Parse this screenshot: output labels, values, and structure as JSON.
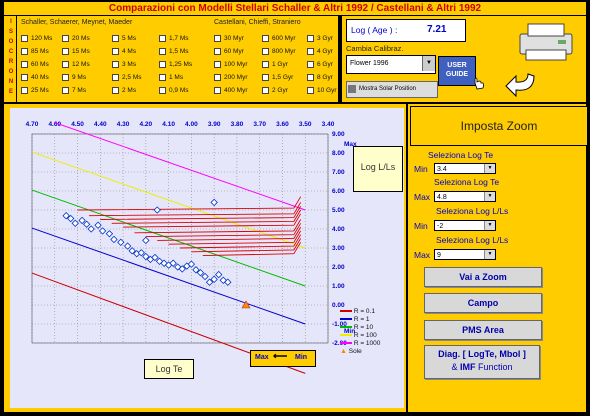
{
  "title": "Comparazioni con Modelli Stellari Schaller & Altri 1992 / Castellani & Altri 1992",
  "isocrone_label": "ISOCRONE",
  "isocrone_letters": [
    "I",
    "S",
    "O",
    "C",
    "R",
    "O",
    "N",
    "E"
  ],
  "group_left": {
    "header": "Schaller, Schaerer, Meynet, Maeder",
    "items": [
      "120 Ms",
      "20 Ms",
      "5 Ms",
      "1,7 Ms",
      "85 Ms",
      "15 Ms",
      "4 Ms",
      "1,5 Ms",
      "60 Ms",
      "12 Ms",
      "3 Ms",
      "1,25 Ms",
      "40 Ms",
      "9 Ms",
      "2,5 Ms",
      "1 Ms",
      "25 Ms",
      "7 Ms",
      "2 Ms",
      "0,9 Ms"
    ]
  },
  "group_right": {
    "header": "Castellani, Chieffi, Straniero",
    "items": [
      "30 Myr",
      "600 Myr",
      "3 Gyr",
      "60 Myr",
      "800 Myr",
      "4 Gyr",
      "100 Myr",
      "1 Gyr",
      "6 Gyr",
      "200 Myr",
      "1,5 Gyr",
      "8 Gyr",
      "400 Myr",
      "2 Gyr",
      "10 Gyr"
    ]
  },
  "log_age": {
    "label": "Log ( Age ) :",
    "value": "7.21"
  },
  "calibraz": {
    "label": "Cambia Calibraz.",
    "value": "Flower 1996"
  },
  "user_guide": "USER GUIDE",
  "sun_button": "Mostra Solar Position",
  "zoom": {
    "title": "Imposta Zoom",
    "te_header": "Seleziona Log Te",
    "te_min": "3.4",
    "te_max": "4.8",
    "ll_header": "Seleziona Log L/Ls",
    "ll_min": "-2",
    "ll_max": "9",
    "min_label": "Min",
    "max_label": "Max"
  },
  "buttons": {
    "vai_zoom": "Vai a Zoom",
    "campo": "Campo",
    "pms": "PMS Area",
    "diag_line1": "Diag. [ LogTe, Mbol ]",
    "diag_line2_pre": "& ",
    "diag_line2_imf": "IMF",
    "diag_line2_post": " Function"
  },
  "chart_data": {
    "type": "scatter",
    "xlabel": "Log Te",
    "ylabel": "Log L/Ls",
    "x_ticks": [
      "4.70",
      "4.60",
      "4.50",
      "4.40",
      "4.30",
      "4.20",
      "4.10",
      "4.00",
      "3.90",
      "3.80",
      "3.70",
      "3.60",
      "3.50",
      "3.40"
    ],
    "y_ticks": [
      "9.00",
      "8.00",
      "7.00",
      "6.00",
      "5.00",
      "4.00",
      "3.00",
      "2.00",
      "1.00",
      "0.00",
      "-1.00",
      "-2.00"
    ],
    "xlim": [
      4.7,
      3.4
    ],
    "ylim": [
      -2,
      9
    ],
    "corner_labels": {
      "max_top": "Max",
      "min_right": "Min"
    },
    "direction_label": {
      "max": "Max",
      "min": "Min"
    },
    "legend": [
      {
        "label": "R = 0.1",
        "color": "#cc0000"
      },
      {
        "label": "R = 1",
        "color": "#0000cc"
      },
      {
        "label": "R = 10",
        "color": "#00bb00"
      },
      {
        "label": "R = 100",
        "color": "#eeee00"
      },
      {
        "label": "R = 1000",
        "color": "#ff00ff"
      },
      {
        "label": "Sole",
        "color": "#ff8800"
      }
    ],
    "radius_lines": [
      {
        "name": "R = 0.1",
        "color": "#cc0000",
        "points": [
          [
            4.7,
            1.68
          ],
          [
            3.5,
            -3.6
          ]
        ]
      },
      {
        "name": "R = 1",
        "color": "#0000cc",
        "points": [
          [
            4.7,
            4.05
          ],
          [
            3.5,
            -1.0
          ]
        ]
      },
      {
        "name": "R = 10",
        "color": "#00bb00",
        "points": [
          [
            4.7,
            6.05
          ],
          [
            3.5,
            1.0
          ]
        ]
      },
      {
        "name": "R = 100",
        "color": "#eeee00",
        "points": [
          [
            4.7,
            8.05
          ],
          [
            3.5,
            3.0
          ]
        ]
      },
      {
        "name": "R = 1000",
        "color": "#ff00ff",
        "points": [
          [
            4.6,
            9.6
          ],
          [
            3.5,
            5.0
          ]
        ]
      }
    ],
    "stars": [
      [
        4.55,
        4.7
      ],
      [
        4.53,
        4.55
      ],
      [
        4.51,
        4.3
      ],
      [
        4.48,
        4.45
      ],
      [
        4.46,
        4.25
      ],
      [
        4.44,
        4.0
      ],
      [
        4.41,
        4.2
      ],
      [
        4.39,
        3.9
      ],
      [
        4.36,
        3.75
      ],
      [
        4.34,
        3.45
      ],
      [
        4.31,
        3.3
      ],
      [
        4.28,
        3.1
      ],
      [
        4.26,
        2.85
      ],
      [
        4.24,
        2.7
      ],
      [
        4.22,
        2.75
      ],
      [
        4.2,
        2.55
      ],
      [
        4.18,
        2.4
      ],
      [
        4.16,
        2.5
      ],
      [
        4.14,
        2.3
      ],
      [
        4.12,
        2.2
      ],
      [
        4.1,
        2.1
      ],
      [
        4.08,
        2.2
      ],
      [
        4.06,
        2.0
      ],
      [
        4.04,
        1.9
      ],
      [
        4.02,
        2.05
      ],
      [
        4.0,
        2.15
      ],
      [
        3.98,
        1.85
      ],
      [
        3.96,
        1.7
      ],
      [
        3.94,
        1.5
      ],
      [
        3.92,
        1.2
      ],
      [
        3.9,
        1.35
      ],
      [
        3.88,
        1.6
      ],
      [
        3.86,
        1.3
      ],
      [
        3.84,
        1.2
      ],
      [
        4.15,
        5.0
      ],
      [
        3.9,
        5.4
      ],
      [
        4.2,
        3.4
      ]
    ],
    "sun": [
      3.76,
      0.0
    ]
  }
}
